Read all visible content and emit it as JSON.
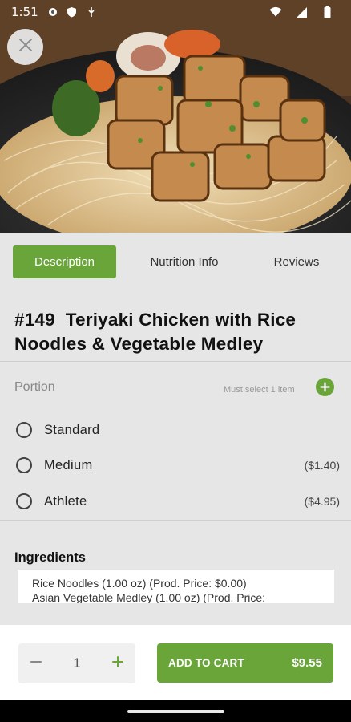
{
  "status_bar": {
    "time": "1:51",
    "left_icons": [
      "gear-icon",
      "shield-icon",
      "usb-icon"
    ],
    "right_icons": [
      "wifi-icon",
      "signal-icon",
      "battery-icon"
    ]
  },
  "hero": {
    "image": "teriyaki-chicken-noodles-photo",
    "close_icon": "close-icon"
  },
  "tabs": [
    {
      "label": "Description",
      "active": true
    },
    {
      "label": "Nutrition Info",
      "active": false
    },
    {
      "label": "Reviews",
      "active": false
    }
  ],
  "product": {
    "title_line1": "#149  Teriyaki Chicken with Rice",
    "title_line2": "Noodles & Vegetable Medley"
  },
  "portion": {
    "label": "Portion",
    "hint": "Must select 1 item",
    "add_icon": "plus-circle-icon",
    "options": [
      {
        "label": "Standard",
        "price": ""
      },
      {
        "label": "Medium",
        "price": "($1.40)"
      },
      {
        "label": "Athlete",
        "price": "($4.95)"
      }
    ]
  },
  "ingredients": {
    "label": "Ingredients",
    "lines": [
      "Rice Noodles (1.00 oz) (Prod. Price: $0.00)",
      "Asian Vegetable Medley (1.00 oz) (Prod. Price:"
    ]
  },
  "cart": {
    "quantity": "1",
    "decrement_icon": "minus-icon",
    "increment_icon": "plus-icon",
    "add_label": "ADD TO CART",
    "price": "$9.55"
  },
  "colors": {
    "accent": "#6aa53a",
    "background": "#e6e6e6"
  }
}
